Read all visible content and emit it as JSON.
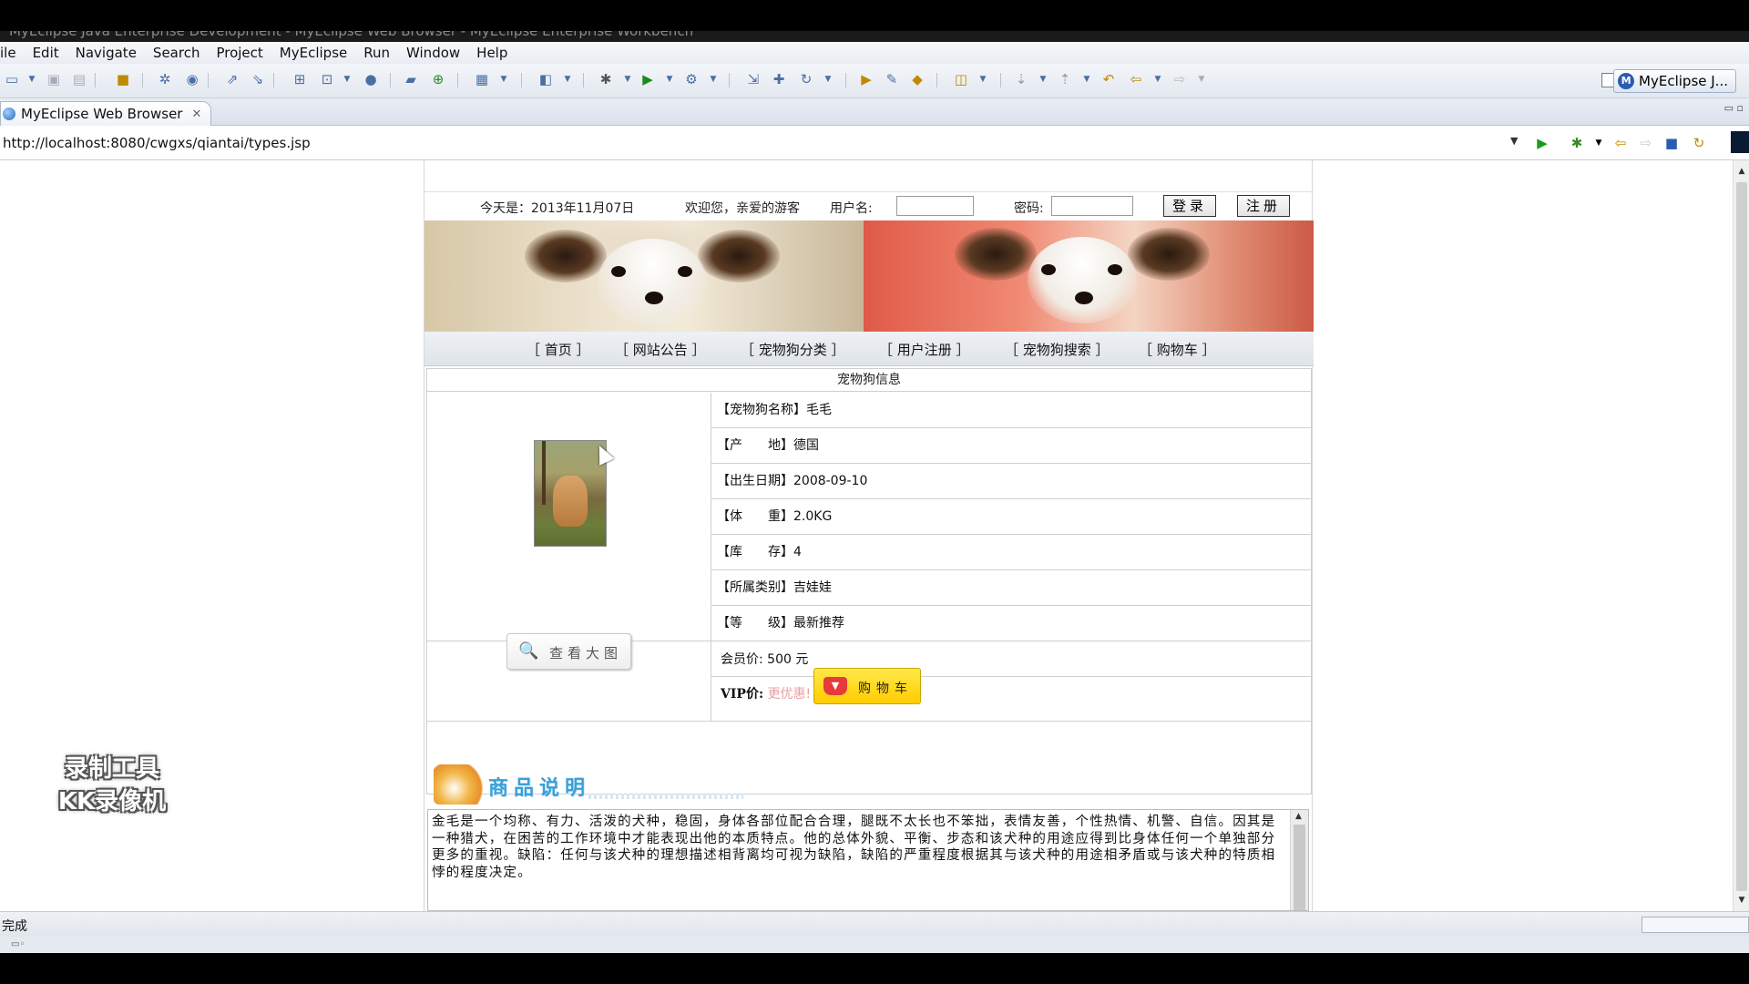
{
  "window": {
    "title": "MyEclipse Java Enterprise Development - MyEclipse Web Browser - MyEclipse Enterprise Workbench"
  },
  "menu": {
    "items": [
      "ile",
      "Edit",
      "Navigate",
      "Search",
      "Project",
      "MyEclipse",
      "Run",
      "Window",
      "Help"
    ]
  },
  "toolbar": {
    "perspective_label": "MyEclipse J...",
    "perspective_badge": "M"
  },
  "editor_tab": {
    "label": "MyEclipse Web Browser",
    "close_glyph": "✕"
  },
  "address": {
    "url": "http://localhost:8080/cwgxs/qiantai/types.jsp"
  },
  "site": {
    "login_bar": {
      "date_text": "今天是：2013年11月07日",
      "welcome_text": "欢迎您，亲爱的游客",
      "username_label": "用户名:",
      "username_value": "",
      "password_label": "密码:",
      "password_value": "",
      "login_button": "登录",
      "register_button": "注册"
    },
    "nav": [
      "［ 首页 ］",
      "［ 网站公告 ］",
      "［ 宠物狗分类 ］",
      "［ 用户注册 ］",
      "［ 宠物狗搜索 ］",
      "［ 购物车 ］"
    ],
    "pet": {
      "section_title": "宠物狗信息",
      "attributes": [
        {
          "label": "【宠物狗名称】",
          "value": "毛毛"
        },
        {
          "label": "【产　　地】",
          "value": "德国"
        },
        {
          "label": "【出生日期】",
          "value": "2008-09-10"
        },
        {
          "label": "【体　　重】",
          "value": "2.0KG"
        },
        {
          "label": "【库　　存】",
          "value": "4"
        },
        {
          "label": "【所属类别】",
          "value": "吉娃娃"
        },
        {
          "label": "【等　　级】",
          "value": "最新推荐"
        }
      ],
      "member_price_label": "会员价:",
      "member_price_value": "500 元",
      "vip_price_label": "VIP价:",
      "vip_price_value": "更优惠!",
      "view_large_button": "查看大图",
      "cart_button": "购物车"
    },
    "description": {
      "title": "商品说明",
      "text": "金毛是一个均称、有力、活泼的犬种，稳固，身体各部位配合合理，腿既不太长也不笨拙，表情友善，个性热情、机警、自信。因其是一种猎犬，在困苦的工作环境中才能表现出他的本质特点。他的总体外貌、平衡、步态和该犬种的用途应得到比身体任何一个单独部分更多的重视。缺陷：任何与该犬种的理想描述相背离均可视为缺陷，缺陷的严重程度根据其与该犬种的用途相矛盾或与该犬种的特质相悖的程度决定。"
    }
  },
  "overlay": {
    "watermark_line1": "录制工具",
    "watermark_line2": "KK录像机"
  },
  "status": {
    "text": "完成"
  }
}
